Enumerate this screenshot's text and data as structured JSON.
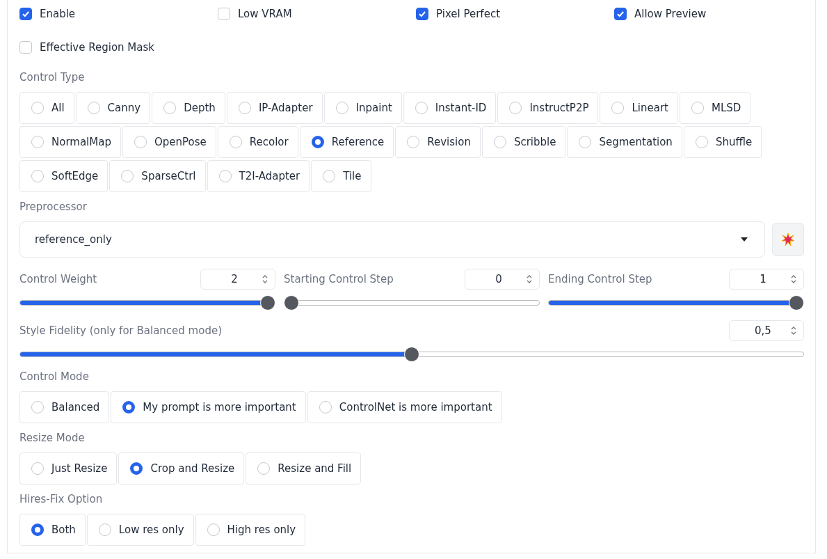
{
  "checkboxes": [
    {
      "label": "Enable",
      "checked": true
    },
    {
      "label": "Low VRAM",
      "checked": false
    },
    {
      "label": "Pixel Perfect",
      "checked": true
    },
    {
      "label": "Allow Preview",
      "checked": true
    }
  ],
  "effective_region_mask": {
    "label": "Effective Region Mask",
    "checked": false
  },
  "control_type": {
    "label": "Control Type",
    "options": [
      {
        "label": "All",
        "selected": false
      },
      {
        "label": "Canny",
        "selected": false
      },
      {
        "label": "Depth",
        "selected": false
      },
      {
        "label": "IP-Adapter",
        "selected": false
      },
      {
        "label": "Inpaint",
        "selected": false
      },
      {
        "label": "Instant-ID",
        "selected": false
      },
      {
        "label": "InstructP2P",
        "selected": false
      },
      {
        "label": "Lineart",
        "selected": false
      },
      {
        "label": "MLSD",
        "selected": false
      },
      {
        "label": "NormalMap",
        "selected": false
      },
      {
        "label": "OpenPose",
        "selected": false
      },
      {
        "label": "Recolor",
        "selected": false
      },
      {
        "label": "Reference",
        "selected": true
      },
      {
        "label": "Revision",
        "selected": false
      },
      {
        "label": "Scribble",
        "selected": false
      },
      {
        "label": "Segmentation",
        "selected": false
      },
      {
        "label": "Shuffle",
        "selected": false
      },
      {
        "label": "SoftEdge",
        "selected": false
      },
      {
        "label": "SparseCtrl",
        "selected": false
      },
      {
        "label": "T2I-Adapter",
        "selected": false
      },
      {
        "label": "Tile",
        "selected": false
      }
    ]
  },
  "preprocessor": {
    "label": "Preprocessor",
    "value": "reference_only"
  },
  "sliders": [
    {
      "label": "Control Weight",
      "value": "2",
      "level": 1
    },
    {
      "label": "Starting Control Step",
      "value": "0",
      "level": 0
    },
    {
      "label": "Ending Control Step",
      "value": "1",
      "level": 1
    }
  ],
  "style_fidelity": {
    "label": "Style Fidelity (only for Balanced mode)",
    "value": "0,5",
    "level": 0.5
  },
  "radio_groups": [
    {
      "label": "Control Mode",
      "options": [
        {
          "label": "Balanced",
          "selected": false
        },
        {
          "label": "My prompt is more important",
          "selected": true
        },
        {
          "label": "ControlNet is more important",
          "selected": false
        }
      ]
    },
    {
      "label": "Resize Mode",
      "options": [
        {
          "label": "Just Resize",
          "selected": false
        },
        {
          "label": "Crop and Resize",
          "selected": true
        },
        {
          "label": "Resize and Fill",
          "selected": false
        }
      ]
    },
    {
      "label": "Hires-Fix Option",
      "options": [
        {
          "label": "Both",
          "selected": true
        },
        {
          "label": "Low res only",
          "selected": false
        },
        {
          "label": "High res only",
          "selected": false
        }
      ]
    }
  ]
}
